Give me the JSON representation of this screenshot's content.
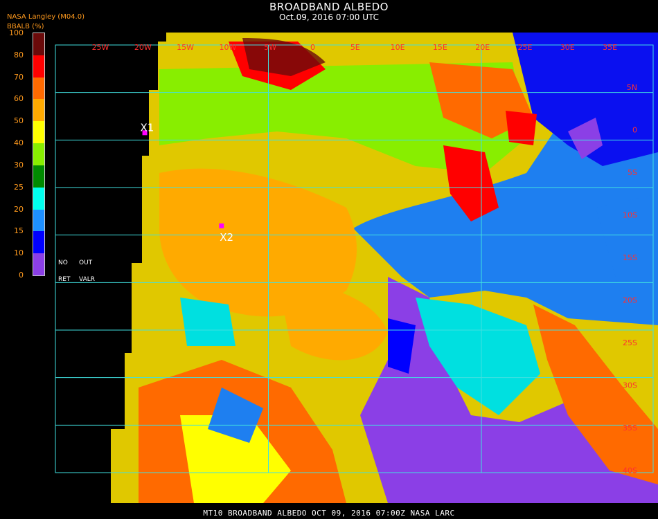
{
  "header": {
    "title": "BROADBAND ALBEDO",
    "date": "Oct.09, 2016 07:00 UTC",
    "org": "NASA Langley (M04.0)",
    "unit": "BBALB (%)"
  },
  "colorbar": {
    "ticks": [
      "100",
      "80",
      "70",
      "60",
      "50",
      "40",
      "30",
      "25",
      "20",
      "15",
      "10",
      "0"
    ],
    "colors": [
      "#6a0a0a",
      "#ff0000",
      "#ff6a00",
      "#ffaa00",
      "#ffff00",
      "#88ee00",
      "#008a00",
      "#00ffee",
      "#1e90ff",
      "#0000ff",
      "#8b3fe6"
    ],
    "no_ret": [
      "NO",
      "RET"
    ],
    "out_valr": [
      "OUT",
      "VALR"
    ]
  },
  "map": {
    "lon_labels": [
      "25W",
      "20W",
      "15W",
      "10W",
      "5W",
      "0",
      "5E",
      "10E",
      "15E",
      "20E",
      "25E",
      "30E",
      "35E"
    ],
    "lat_labels": [
      "5N",
      "0",
      "5S",
      "10S",
      "15S",
      "20S",
      "25S",
      "30S",
      "35S",
      "40S"
    ],
    "markers": [
      {
        "label": "X1",
        "lon": -15.2,
        "lat": -4.2
      },
      {
        "label": "X2",
        "lon": -6.2,
        "lat": -14.0
      }
    ],
    "grid_color": "#40e0e0",
    "marker_color": "#ff00ff"
  },
  "footer": {
    "text": "MT10  BROADBAND ALBEDO   OCT 09, 2016 07:00Z   NASA LARC"
  }
}
